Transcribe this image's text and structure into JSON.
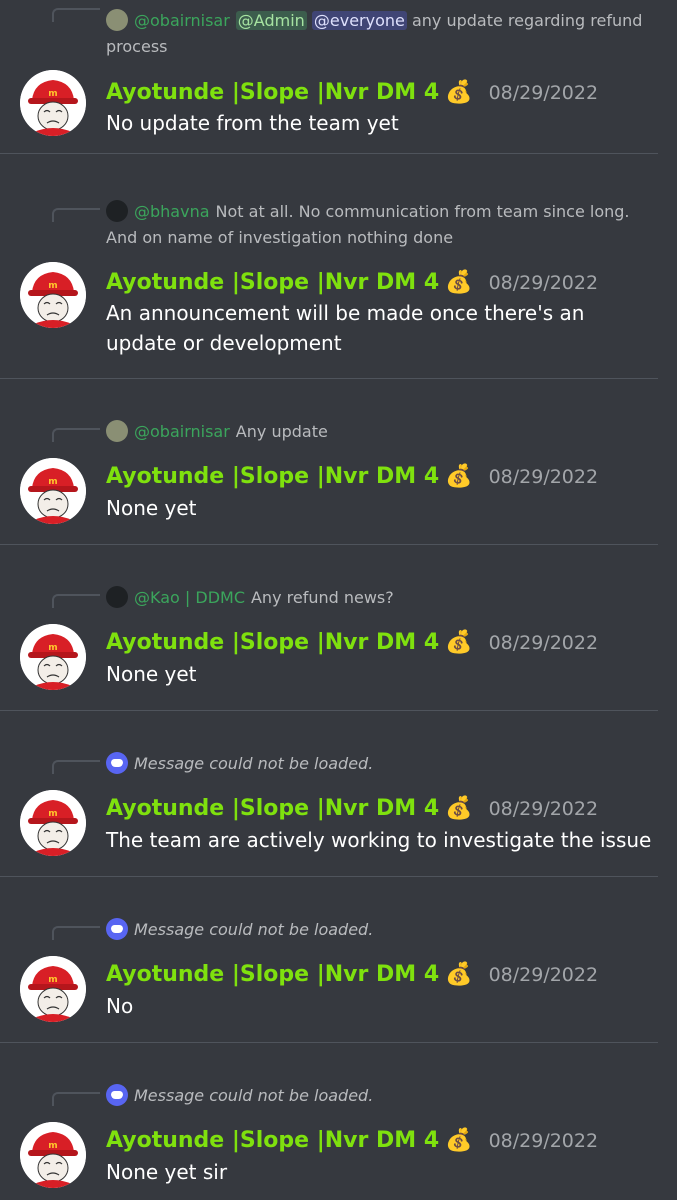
{
  "messages": [
    {
      "reply_user": "@obairnisar",
      "reply_mentions": [
        "@Admin",
        "@everyone"
      ],
      "reply_text": "any update regarding refund process",
      "username": "Ayotunde |Slope |Nvr DM 4",
      "timestamp": "08/29/2022",
      "content": "No update from the team yet"
    },
    {
      "reply_user": "@bhavna",
      "reply_text": "Not at all. No communication from team since long. And on name of investigation nothing done",
      "username": "Ayotunde |Slope |Nvr DM 4",
      "timestamp": "08/29/2022",
      "content": "An announcement will be made once there's an update or development"
    },
    {
      "reply_user": "@obairnisar",
      "reply_text": "Any update",
      "username": "Ayotunde |Slope |Nvr DM 4",
      "timestamp": "08/29/2022",
      "content": "None yet"
    },
    {
      "reply_user": "@Kao | DDMC",
      "reply_text": "Any refund news?",
      "username": "Ayotunde |Slope |Nvr DM 4",
      "timestamp": "08/29/2022",
      "content": "None yet"
    },
    {
      "reply_text": "Message could not be loaded.",
      "username": "Ayotunde |Slope |Nvr DM 4",
      "timestamp": "08/29/2022",
      "content": "The team are actively working to investigate the issue"
    },
    {
      "reply_text": "Message could not be loaded.",
      "username": "Ayotunde |Slope |Nvr DM 4",
      "timestamp": "08/29/2022",
      "content": "No"
    },
    {
      "reply_text": "Message could not be loaded.",
      "username": "Ayotunde |Slope |Nvr DM 4",
      "timestamp": "08/29/2022",
      "content": "None yet sir"
    }
  ],
  "icons": {
    "badge": "money-bag-icon",
    "unloaded_reply": "discord-icon",
    "avatar": "wojak-mcdonalds-avatar"
  },
  "colors": {
    "background": "#36393f",
    "username": "#7fe10e",
    "reply_name": "#3ba55c",
    "mention": "#5865f2"
  }
}
